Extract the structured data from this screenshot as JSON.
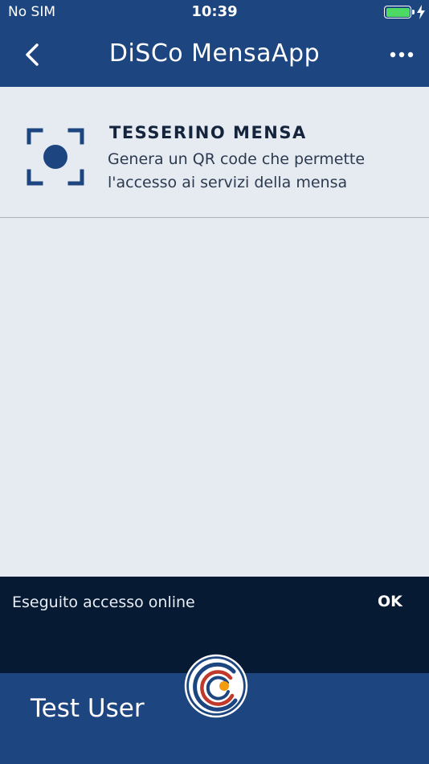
{
  "status_bar": {
    "carrier": "No SIM",
    "time": "10:39",
    "battery_level": 1.0,
    "charging": true
  },
  "nav": {
    "title": "DiSCo MensaApp",
    "back_icon": "chevron-left-icon",
    "more_icon": "more-horizontal-icon"
  },
  "card": {
    "title": "TESSERINO MENSA",
    "description_line1": "Genera un QR code che permette",
    "description_line2": "l'accesso ai servizi della mensa",
    "icon": "scan-frame-icon"
  },
  "snackbar": {
    "message": "Eseguito accesso online",
    "action": "OK"
  },
  "footer": {
    "user_name": "Test User",
    "logo_icon": "disco-logo-icon"
  },
  "colors": {
    "primary": "#1d4580",
    "background": "#e6ebf2",
    "snackbar": "#061a33",
    "battery": "#4cd964",
    "logo_red": "#c0392b",
    "logo_orange": "#f39c12"
  }
}
